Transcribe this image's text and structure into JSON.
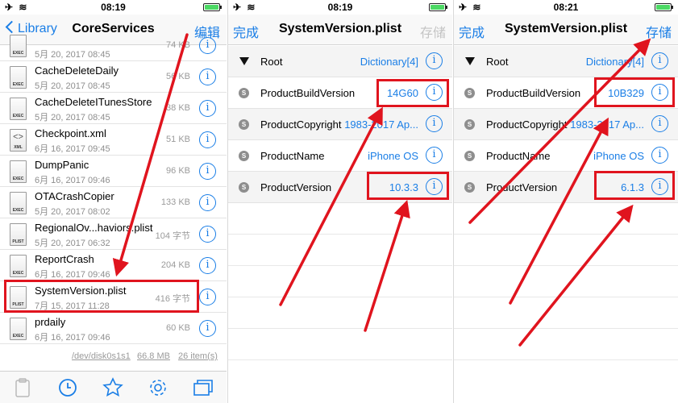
{
  "status": {
    "s1_time": "08:19",
    "s2_time": "08:19",
    "s3_time": "08:21"
  },
  "screen1": {
    "back_label": "Library",
    "title": "CoreServices",
    "edit_label": "编辑",
    "files": [
      {
        "name": "",
        "date": "5月 20, 2017 08:45",
        "size": "74 KB",
        "icon": "exec-icon",
        "tag": "EXEC"
      },
      {
        "name": "CacheDeleteDaily",
        "date": "5月 20, 2017 08:45",
        "size": "56 KB",
        "icon": "exec-icon",
        "tag": "EXEC"
      },
      {
        "name": "CacheDeleteITunesStore",
        "date": "5月 20, 2017 08:45",
        "size": "38 KB",
        "icon": "exec-icon",
        "tag": "EXEC"
      },
      {
        "name": "Checkpoint.xml",
        "date": "6月 16, 2017 09:45",
        "size": "51 KB",
        "icon": "xml-icon",
        "tag": "XML"
      },
      {
        "name": "DumpPanic",
        "date": "6月 16, 2017 09:46",
        "size": "96 KB",
        "icon": "exec-icon",
        "tag": "EXEC"
      },
      {
        "name": "OTACrashCopier",
        "date": "5月 20, 2017 08:02",
        "size": "133 KB",
        "icon": "exec-icon",
        "tag": "EXEC"
      },
      {
        "name": "RegionalOv...haviors.plist",
        "date": "5月 20, 2017 06:32",
        "size": "104 字节",
        "icon": "plist-icon",
        "tag": "PLIST"
      },
      {
        "name": "ReportCrash",
        "date": "6月 16, 2017 09:46",
        "size": "204 KB",
        "icon": "exec-icon",
        "tag": "EXEC"
      },
      {
        "name": "SystemVersion.plist",
        "date": "7月 15, 2017 11:28",
        "size": "416 字节",
        "icon": "plist-icon",
        "tag": "PLIST"
      },
      {
        "name": "prdaily",
        "date": "6月 16, 2017 09:46",
        "size": "60 KB",
        "icon": "exec-icon",
        "tag": "EXEC"
      }
    ],
    "footer_path": "/dev/disk0s1s1",
    "footer_size": "66.8 MB",
    "footer_count": "26 item(s)"
  },
  "screen2": {
    "done_label": "完成",
    "title": "SystemVersion.plist",
    "save_label": "存储",
    "rows": [
      {
        "key": "Root",
        "value": "Dictionary[4]",
        "type": "root"
      },
      {
        "key": "ProductBuildVersion",
        "value": "14G60",
        "type": "string"
      },
      {
        "key": "ProductCopyright",
        "value": "1983-2017 Ap...",
        "type": "string"
      },
      {
        "key": "ProductName",
        "value": "iPhone OS",
        "type": "string"
      },
      {
        "key": "ProductVersion",
        "value": "10.3.3",
        "type": "string"
      }
    ]
  },
  "screen3": {
    "done_label": "完成",
    "title": "SystemVersion.plist",
    "save_label": "存储",
    "rows": [
      {
        "key": "Root",
        "value": "Dictionary[4]",
        "type": "root"
      },
      {
        "key": "ProductBuildVersion",
        "value": "10B329",
        "type": "string"
      },
      {
        "key": "ProductCopyright",
        "value": "1983-2017 Ap...",
        "type": "string"
      },
      {
        "key": "ProductName",
        "value": "iPhone OS",
        "type": "string"
      },
      {
        "key": "ProductVersion",
        "value": "6.1.3",
        "type": "string"
      }
    ]
  },
  "glyphs": {
    "info": "i",
    "string_type": "S",
    "status_left": "✈ ≋",
    "xml_glyph": "<>"
  },
  "colors": {
    "accent": "#1a7ee6",
    "annotation": "#e0141e",
    "battery": "#4cd964"
  }
}
